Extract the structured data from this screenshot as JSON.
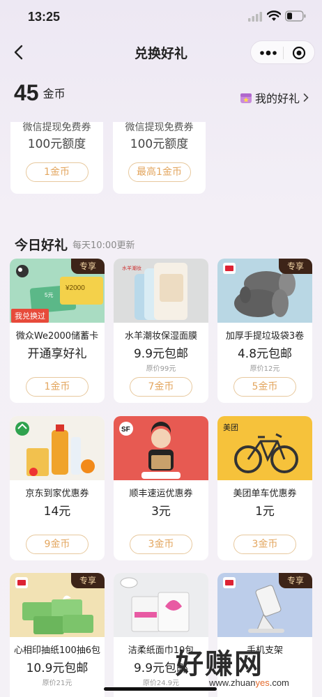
{
  "status_bar": {
    "time": "13:25"
  },
  "navbar": {
    "title": "兑换好礼"
  },
  "header": {
    "coin_count": "45",
    "coin_unit": "金币",
    "my_gifts": "我的好礼"
  },
  "top_cards": [
    {
      "line1": "微信提现免费券",
      "line2": "100元额度",
      "button": "1金币"
    },
    {
      "line1": "微信提现免费券",
      "line2": "100元额度",
      "button": "最高1金币"
    }
  ],
  "section": {
    "title": "今日好礼",
    "subtitle": "每天10:00更新"
  },
  "labels": {
    "exclusive": "专享",
    "exchanged": "我兑换过"
  },
  "products": [
    {
      "name": "微众We2000储蓄卡",
      "price": "开通享好礼",
      "original": "",
      "button": "1金币"
    },
    {
      "name": "水羊潮妆保湿面膜",
      "price": "9.9元包邮",
      "original": "原价99元",
      "button": "7金币"
    },
    {
      "name": "加厚手提垃圾袋3卷",
      "price": "4.8元包邮",
      "original": "原价12元",
      "button": "5金币"
    },
    {
      "name": "京东到家优惠券",
      "price": "14元",
      "original": "",
      "button": "9金币"
    },
    {
      "name": "顺丰速运优惠券",
      "price": "3元",
      "original": "",
      "button": "3金币"
    },
    {
      "name": "美团单车优惠券",
      "price": "1元",
      "original": "",
      "button": "3金币"
    },
    {
      "name": "心相印抽纸100抽6包",
      "price": "10.9元包邮",
      "original": "原价21元",
      "button": ""
    },
    {
      "name": "洁柔纸面巾10包",
      "price": "9.9元包邮",
      "original": "原价24.9元",
      "button": ""
    },
    {
      "name": "手机支架",
      "price": "",
      "original": "",
      "button": ""
    }
  ],
  "image_text": {
    "we_card_amount": "¥2000",
    "we_card_small": "5元",
    "mask_brand": "水羊潮妆",
    "sf_logo": "SF",
    "meituan_logo": "美团"
  },
  "watermark": {
    "big": "好赚网",
    "url_prefix": "www.zhuan",
    "url_highlight": "yes",
    "url_suffix": ".com"
  },
  "colors": {
    "accent": "#e3a65f",
    "badge_bg": "#3d2418",
    "badge_text": "#f6d9a8",
    "exchanged_bg": "#e74a3a"
  }
}
